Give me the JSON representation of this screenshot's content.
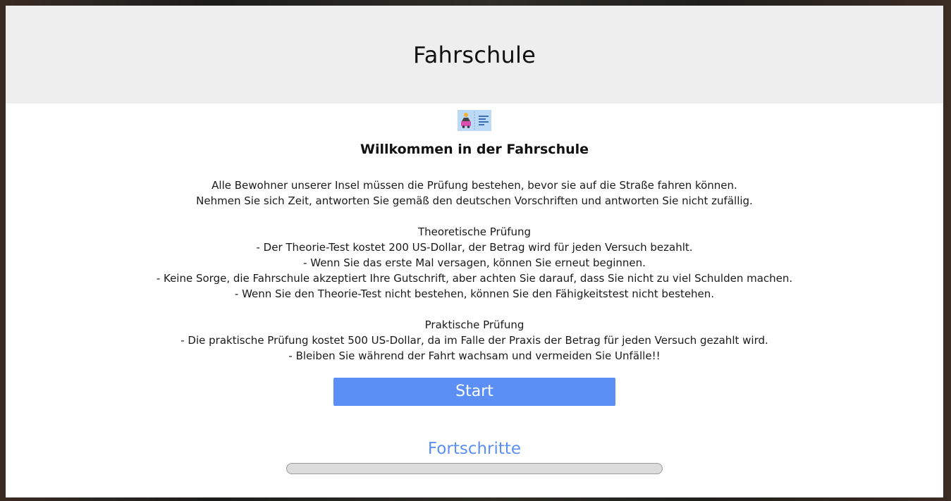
{
  "header": {
    "title": "Fahrschule"
  },
  "logo": {
    "icon": "driving-school-logo-icon"
  },
  "welcome": {
    "title": "Willkommen in der Fahrschule"
  },
  "intro": {
    "lines": [
      "Alle Bewohner unserer Insel müssen die Prüfung bestehen, bevor sie auf die Straße fahren können.",
      "Nehmen Sie sich Zeit, antworten Sie gemäß den deutschen Vorschriften und antworten Sie nicht zufällig."
    ]
  },
  "theory": {
    "title": "Theoretische Prüfung",
    "lines": [
      "- Der Theorie-Test kostet 200 US-Dollar, der Betrag wird für jeden Versuch bezahlt.",
      "- Wenn Sie das erste Mal versagen, können Sie erneut beginnen.",
      "- Keine Sorge, die Fahrschule akzeptiert Ihre Gutschrift, aber achten Sie darauf, dass Sie nicht zu viel Schulden machen.",
      "- Wenn Sie den Theorie-Test nicht bestehen, können Sie den Fähigkeitstest nicht bestehen."
    ]
  },
  "practical": {
    "title": "Praktische Prüfung",
    "lines": [
      "- Die praktische Prüfung kostet 500 US-Dollar, da im Falle der Praxis der Betrag für jeden Versuch gezahlt wird.",
      "- Bleiben Sie während der Fahrt wachsam und vermeiden Sie Unfälle!!"
    ]
  },
  "actions": {
    "start_label": "Start"
  },
  "progress": {
    "title": "Fortschritte",
    "value": 0
  },
  "colors": {
    "accent": "#5b8ff5",
    "header_bg": "#eeeeee"
  }
}
